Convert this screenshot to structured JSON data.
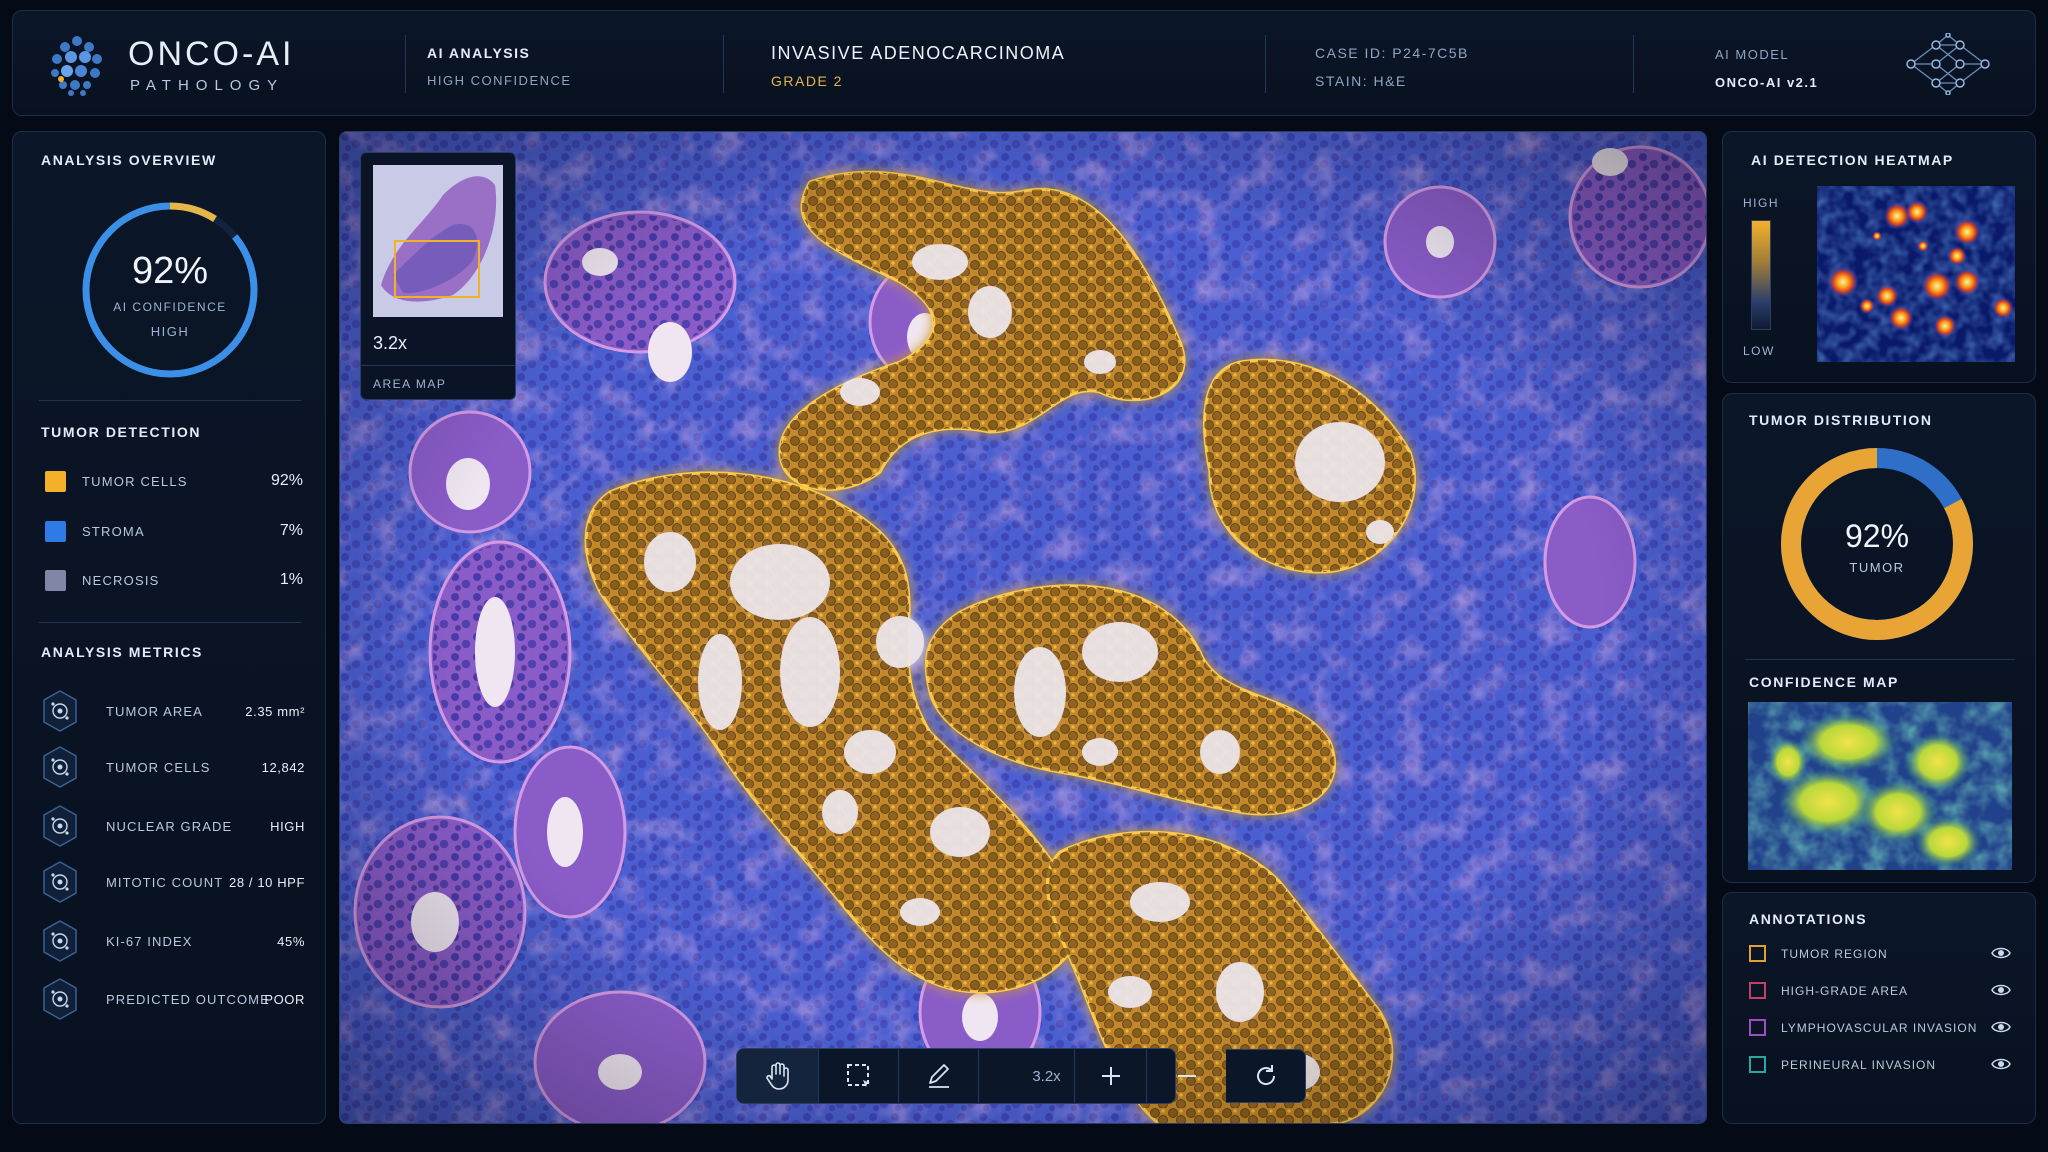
{
  "header": {
    "brand": "ONCO-AI",
    "brand_sub": "PATHOLOGY",
    "analysis_label": "AI ANALYSIS",
    "analysis_value": "HIGH CONFIDENCE",
    "diagnosis": "INVASIVE ADENOCARCINOMA",
    "grade": "GRADE 2",
    "case_id": "CASE ID: P24-7C5B",
    "stain": "STAIN: H&E",
    "model_label": "AI MODEL",
    "model_value": "ONCO-AI v2.1",
    "network_icon": "neural-network-icon"
  },
  "overview": {
    "title": "ANALYSIS OVERVIEW",
    "confidence_value": "92%",
    "confidence_label": "AI CONFIDENCE",
    "confidence_level": "HIGH",
    "confidence_fraction": 0.92
  },
  "tumor_detection": {
    "title": "TUMOR DETECTION",
    "items": [
      {
        "label": "TUMOR CELLS",
        "value": "92%",
        "color": "#f3b12a"
      },
      {
        "label": "STROMA",
        "value": "7%",
        "color": "#2f7ae5"
      },
      {
        "label": "NECROSIS",
        "value": "1%",
        "color": "#7f86a6"
      }
    ]
  },
  "metrics": {
    "title": "ANALYSIS METRICS",
    "items": [
      {
        "label": "TUMOR AREA",
        "value": "2.35 mm²",
        "icon": "cell-cluster-icon"
      },
      {
        "label": "TUMOR CELLS",
        "value": "12,842",
        "icon": "cell-icon"
      },
      {
        "label": "NUCLEAR GRADE",
        "value": "HIGH",
        "icon": "nucleus-icon"
      },
      {
        "label": "MITOTIC COUNT",
        "value": "28 / 10 HPF",
        "icon": "mitosis-icon"
      },
      {
        "label": "KI-67 INDEX",
        "value": "45%",
        "icon": "virus-icon"
      },
      {
        "label": "PREDICTED OUTCOME",
        "value": "POOR",
        "icon": "outcome-icon"
      }
    ]
  },
  "viewer": {
    "zoom": "3.2x",
    "minimap_zoom": "3.2x",
    "minimap_label": "AREA MAP",
    "toolbar_zoom": "3.2x",
    "tools": [
      "hand-icon",
      "select-region-icon",
      "pencil-icon",
      "zoom-in-icon",
      "zoom-out-icon",
      "reset-icon"
    ]
  },
  "heatmap": {
    "title": "AI DETECTION HEATMAP",
    "high_label": "HIGH",
    "low_label": "LOW"
  },
  "distribution": {
    "title": "TUMOR DISTRIBUTION",
    "value": "92%",
    "label": "TUMOR",
    "tumor_fraction": 0.92,
    "colors": {
      "tumor": "#e8a535",
      "other": "#2f6fc8"
    }
  },
  "confidence_map": {
    "title": "CONFIDENCE MAP"
  },
  "annotations": {
    "title": "ANNOTATIONS",
    "items": [
      {
        "label": "TUMOR REGION",
        "color": "#e0a132"
      },
      {
        "label": "HIGH-GRADE AREA",
        "color": "#c2406a"
      },
      {
        "label": "LYMPHOVASCULAR INVASION",
        "color": "#9b4fc4"
      },
      {
        "label": "PERINEURAL INVASION",
        "color": "#2aa7a2"
      }
    ]
  },
  "colors": {
    "accent": "#f3b12a",
    "blue": "#2f7ae5",
    "panel": "#0b1628"
  }
}
